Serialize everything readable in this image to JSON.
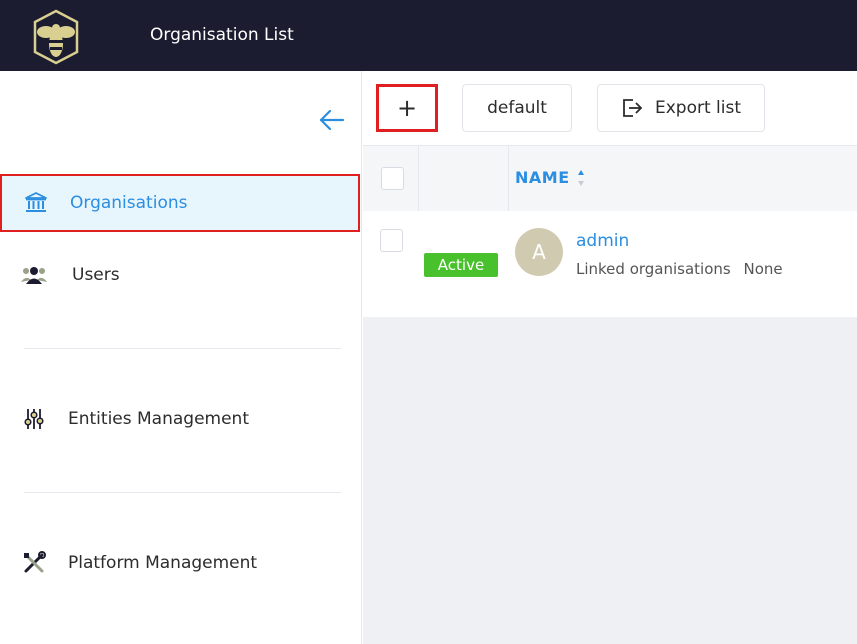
{
  "header": {
    "title": "Organisation List",
    "logo_icon": "bee-logo-icon"
  },
  "sidebar": {
    "collapse_icon": "arrow-left-icon",
    "items": [
      {
        "label": "Organisations",
        "icon": "bank-icon",
        "active": true
      },
      {
        "label": "Users",
        "icon": "users-icon",
        "active": false
      },
      {
        "label": "Entities Management",
        "icon": "sliders-icon",
        "active": false
      },
      {
        "label": "Platform Management",
        "icon": "tools-icon",
        "active": false
      }
    ]
  },
  "toolbar": {
    "add_label": "+",
    "default_label": "default",
    "export_label": "Export list"
  },
  "table": {
    "columns": [
      "NAME"
    ],
    "rows": [
      {
        "status": "Active",
        "avatar_letter": "A",
        "name": "admin",
        "linked_label": "Linked organisations",
        "linked_value": "None"
      }
    ]
  },
  "colors": {
    "topbar": "#1b1c2f",
    "accent": "#2b8ee0",
    "active_bg": "#e7f5fd",
    "highlight": "#e02020",
    "status_active": "#49c12c"
  }
}
